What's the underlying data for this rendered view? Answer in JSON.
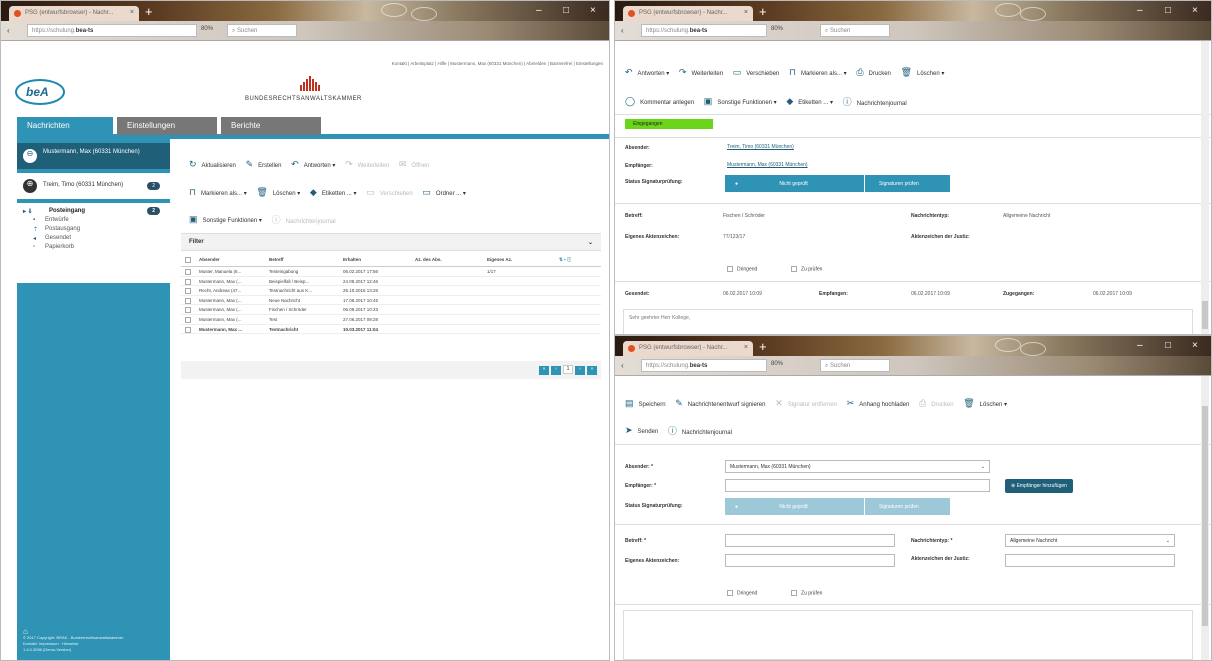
{
  "browser": {
    "tab_title": "PSG (entwurfsbrowser) - Nachr...",
    "url_host": "bea-ts",
    "url_rest": "https://schulung.",
    "zoom": "80%",
    "search_placeholder": "Suchen"
  },
  "left": {
    "top_links": "Kontakt | Arbeitsplatz | Hilfe | Mustermann, Max (60331 München) | Abmelden | Barrierefrei | Einstellungen",
    "logo": "beA",
    "brak": "BUNDESRECHTSANWALTSKAMMER",
    "nav_tabs": [
      "Nachrichten",
      "Einstellungen",
      "Berichte"
    ],
    "accounts": [
      {
        "name": "Mustermann, Max (60331 München)",
        "count": ""
      },
      {
        "name": "Treim, Timo (60331 München)",
        "count": "2"
      }
    ],
    "folders": [
      {
        "label": "Posteingang",
        "count": "2",
        "icon": "inbox-icon"
      },
      {
        "label": "Entwürfe",
        "icon": "draft-icon"
      },
      {
        "label": "Postausgang",
        "icon": "outbox-icon"
      },
      {
        "label": "Gesendet",
        "icon": "sent-icon"
      },
      {
        "label": "Papierkorb",
        "icon": "trash-icon"
      }
    ],
    "footer": [
      "© 2017 Copyright: BRAK - Bundesrechtsanwaltskammer",
      "Kontakt: Impressum · Hinweise",
      "1.4.0.3096 (Demo-Version)"
    ],
    "toolbar": {
      "aktualisieren": "Aktualisieren",
      "erstellen": "Erstellen",
      "antworten": "Antworten",
      "weiterleiten": "Weiterleiten",
      "oeffnen": "Öffnen",
      "markieren": "Markieren als...",
      "loeschen": "Löschen",
      "etiketten": "Etiketten ...",
      "verschieben": "Verschieben",
      "ordner": "Ordner ...",
      "sonstige": "Sonstige Funktionen",
      "journal": "Nachrichtenjournal"
    },
    "filter_label": "Filter",
    "columns": [
      "Absender",
      "Betreff",
      "Erhalten",
      "Az. des Abs.",
      "Eigenes Az."
    ],
    "rows": [
      {
        "absender": "Muster, Manuela (6...",
        "betreff": "Testeingabung",
        "erhalten": "06.02.2017 17:56",
        "az": "",
        "eigen": "1/17",
        "bold": false
      },
      {
        "absender": "Mustermann, Max (...",
        "betreff": "Beispielfall / Beisp...",
        "erhalten": "24.08.2017 12:46",
        "az": "",
        "eigen": "",
        "bold": false
      },
      {
        "absender": "Recht, Andreas (47...",
        "betreff": "Testnachricht aus K...",
        "erhalten": "26.10.2016 13:26",
        "az": "",
        "eigen": "",
        "bold": false
      },
      {
        "absender": "Mustermann, Max (...",
        "betreff": "Neue Nachricht",
        "erhalten": "17.08.2017 10:45",
        "az": "",
        "eigen": "",
        "bold": false
      },
      {
        "absender": "Mustermann, Max (...",
        "betreff": "Fischen / Schröder",
        "erhalten": "06.09.2017 10:23",
        "az": "",
        "eigen": "",
        "bold": false
      },
      {
        "absender": "Mustermann, Max (...",
        "betreff": "Test",
        "erhalten": "27.06.2017 09:28",
        "az": "",
        "eigen": "",
        "bold": false
      },
      {
        "absender": "Mustermann, Max ...",
        "betreff": "Testnachricht",
        "erhalten": "10.03.2017 11:04",
        "az": "",
        "eigen": "",
        "bold": true
      }
    ],
    "page": "1"
  },
  "right_top": {
    "toolbar": {
      "antworten": "Antworten",
      "weiterleiten": "Weiterleiten",
      "verschieben": "Verschieben",
      "markieren": "Markieren als...",
      "drucken": "Drucken",
      "loeschen": "Löschen",
      "kommentar": "Kommentar anlegen",
      "sonstige": "Sonstige Funktionen",
      "etiketten": "Etiketten ...",
      "journal": "Nachrichtenjournal"
    },
    "status": "Eingegangen",
    "absender_label": "Absender:",
    "absender": "Treim, Timo (60331 München)",
    "empfaenger_label": "Empfänger:",
    "empfaenger": "Mustermann, Max (60331 München)",
    "sig_label": "Status Signaturprüfung:",
    "sig_state": "Nicht geprüft",
    "sig_check": "Signaturen prüfen",
    "betreff_label": "Betreff:",
    "betreff": "Fischen / Schröder",
    "typ_label": "Nachrichtentyp:",
    "typ": "Allgemeine Nachricht",
    "az_label": "Eigenes Aktenzeichen:",
    "az": "77/123/17",
    "az_justiz_label": "Aktenzeichen der Justiz:",
    "dringend": "Dringend",
    "zu_pruefen": "Zu prüfen",
    "gesendet_label": "Gesendet:",
    "gesendet": "06.02.2017 10:09",
    "empfangen_label": "Empfangen:",
    "empfangen": "06.02.2017 10:09",
    "zugegangen_label": "Zugegangen:",
    "zugegangen": "06.02.2017 10:09",
    "body": "Sehr geehrter Herr Kollege,"
  },
  "right_bottom": {
    "toolbar": {
      "speichern": "Speichern",
      "signieren": "Nachrichtenentwurf signieren",
      "sig_entfernen": "Signatur entfernen",
      "anhang": "Anhang hochladen",
      "drucken": "Drucken",
      "loeschen": "Löschen",
      "senden": "Senden",
      "journal": "Nachrichtenjournal"
    },
    "absender_label": "Absender: *",
    "absender": "Mustermann, Max (60331 München)",
    "empfaenger_label": "Empfänger: *",
    "empfaenger_add": "Empfänger hinzufügen",
    "sig_label": "Status Signaturprüfung:",
    "sig_state": "Nicht geprüft",
    "sig_check": "Signaturen prüfen",
    "betreff_label": "Betreff: *",
    "typ_label": "Nachrichtentyp: *",
    "typ": "Allgemeine Nachricht",
    "az_label": "Eigenes Aktenzeichen:",
    "az_justiz_label": "Aktenzeichen der Justiz:",
    "dringend": "Dringend",
    "zu_pruefen": "Zu prüfen"
  }
}
